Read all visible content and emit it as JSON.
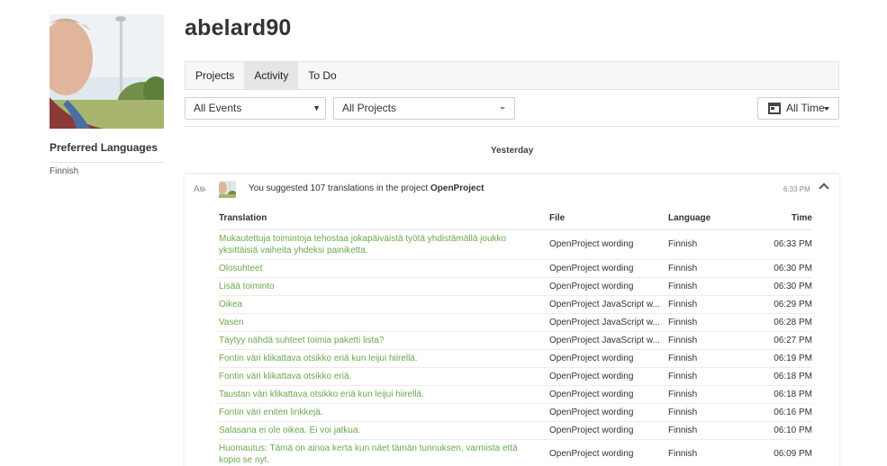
{
  "profile": {
    "username": "abelard90",
    "preferred_languages_title": "Preferred Languages",
    "languages": [
      "Finnish"
    ]
  },
  "tabs": [
    {
      "label": "Projects",
      "active": false
    },
    {
      "label": "Activity",
      "active": true
    },
    {
      "label": "To Do",
      "active": false
    }
  ],
  "filters": {
    "events": "All Events",
    "projects": "All Projects",
    "time": "All Time"
  },
  "feed": {
    "day_label": "Yesterday",
    "activity": {
      "text_prefix": "You suggested 107 translations in the project",
      "project": "OpenProject",
      "time": "6:33 PM"
    },
    "columns": {
      "translation": "Translation",
      "file": "File",
      "language": "Language",
      "time": "Time"
    },
    "rows": [
      {
        "translation": "Mukautettuja toimintoja tehostaa jokapäiväistä työtä yhdistämällä joukko yksittäisiä vaiheita yhdeksi painiketta.",
        "file": "OpenProject wording",
        "language": "Finnish",
        "time": "06:33 PM"
      },
      {
        "translation": "Olosuhteet",
        "file": "OpenProject wording",
        "language": "Finnish",
        "time": "06:30 PM"
      },
      {
        "translation": "Lisää toiminto",
        "file": "OpenProject wording",
        "language": "Finnish",
        "time": "06:30 PM"
      },
      {
        "translation": "Oikea",
        "file": "OpenProject JavaScript w...",
        "language": "Finnish",
        "time": "06:29 PM"
      },
      {
        "translation": "Vasen",
        "file": "OpenProject JavaScript w...",
        "language": "Finnish",
        "time": "06:28 PM"
      },
      {
        "translation": "Täytyy nähdä suhteet toimia paketti lista?",
        "file": "OpenProject JavaScript w...",
        "language": "Finnish",
        "time": "06:27 PM"
      },
      {
        "translation": "Fontin väri klikattava otsikko eriä kun leijui hiirellä.",
        "file": "OpenProject wording",
        "language": "Finnish",
        "time": "06:19 PM"
      },
      {
        "translation": "Fontin väri klikattava otsikko eriä.",
        "file": "OpenProject wording",
        "language": "Finnish",
        "time": "06:18 PM"
      },
      {
        "translation": "Taustan väri klikattava otsikko eriä kun leijui hiirellä.",
        "file": "OpenProject wording",
        "language": "Finnish",
        "time": "06:18 PM"
      },
      {
        "translation": "Fontin väri eniten linkkejä.",
        "file": "OpenProject wording",
        "language": "Finnish",
        "time": "06:16 PM"
      },
      {
        "translation": "Salasana ei ole oikea. Ei voi jatkua.",
        "file": "OpenProject wording",
        "language": "Finnish",
        "time": "06:10 PM"
      },
      {
        "translation": "Huomautus: Tämä on ainoa kerta kun näet tämän tunnuksen, varmista että kopio se nyt.",
        "file": "OpenProject wording",
        "language": "Finnish",
        "time": "06:09 PM"
      }
    ]
  },
  "colors": {
    "translation_link": "#6aa84f",
    "active_tab_bg": "#e6e6e6",
    "tab_bar_bg": "#f7f7f7"
  },
  "icons": {
    "translate": "translate-icon",
    "calendar": "calendar-icon",
    "collapse": "chevron-up-icon"
  }
}
